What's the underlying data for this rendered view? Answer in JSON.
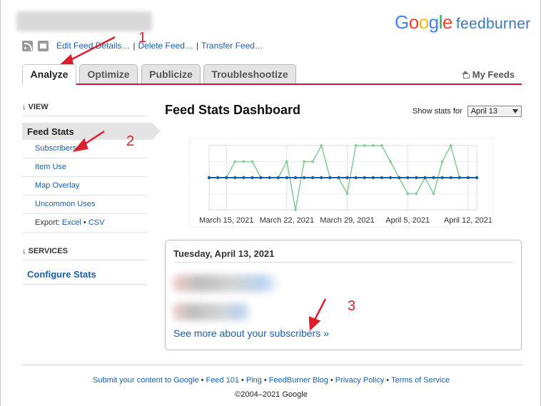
{
  "header": {
    "logo_google": "Google",
    "logo_feedburner": "feedburner",
    "feed_actions": [
      {
        "label": "Edit Feed Details…"
      },
      {
        "label": "Delete Feed…"
      },
      {
        "label": "Transfer Feed…"
      }
    ],
    "separator": "|"
  },
  "tabs": [
    {
      "label": "Analyze",
      "active": true
    },
    {
      "label": "Optimize",
      "active": false
    },
    {
      "label": "Publicize",
      "active": false
    },
    {
      "label": "Troubleshootize",
      "active": false
    }
  ],
  "my_feeds": "My Feeds",
  "sidebar": {
    "view_arrow": "↓",
    "view_heading": "VIEW",
    "current": "Feed Stats",
    "items": [
      {
        "label": "Subscribers"
      },
      {
        "label": "Item Use"
      },
      {
        "label": "Map Overlay"
      },
      {
        "label": "Uncommon Uses"
      }
    ],
    "export_label": "Export:",
    "export_excel": "Excel",
    "export_bullet": "•",
    "export_csv": "CSV",
    "services_arrow": "↓",
    "services_heading": "SERVICES",
    "configure": "Configure Stats"
  },
  "main": {
    "title": "Feed Stats Dashboard",
    "show_stats_label": "Show stats for",
    "show_stats_value": "April 13",
    "day_title": "Tuesday, April 13, 2021",
    "see_more": "See more about your subscribers »"
  },
  "chart_data": {
    "type": "line",
    "x_tick_labels": [
      "March 15, 2021",
      "March 22, 2021",
      "March 29, 2021",
      "April 5, 2021",
      "April 12, 2021"
    ],
    "x": [
      "Mar 13",
      "Mar 14",
      "Mar 15",
      "Mar 16",
      "Mar 17",
      "Mar 18",
      "Mar 19",
      "Mar 20",
      "Mar 21",
      "Mar 22",
      "Mar 23",
      "Mar 24",
      "Mar 25",
      "Mar 26",
      "Mar 27",
      "Mar 28",
      "Mar 29",
      "Mar 30",
      "Mar 31",
      "Apr 1",
      "Apr 2",
      "Apr 3",
      "Apr 4",
      "Apr 5",
      "Apr 6",
      "Apr 7",
      "Apr 8",
      "Apr 9",
      "Apr 10",
      "Apr 11",
      "Apr 12",
      "Apr 13"
    ],
    "series": [
      {
        "color": "#88cc99",
        "values": [
          0,
          0,
          0,
          1,
          1,
          1,
          0,
          0,
          0,
          1,
          -2,
          1,
          1,
          2,
          0,
          0,
          -1,
          2,
          2,
          2,
          2,
          1,
          0,
          -1,
          -1,
          0,
          -1,
          1,
          2,
          0,
          0,
          0
        ]
      },
      {
        "color": "#1c5e9c",
        "values": [
          0,
          0,
          0,
          0,
          0,
          0,
          0,
          0,
          0,
          0,
          0,
          0,
          0,
          0,
          0,
          0,
          0,
          0,
          0,
          0,
          0,
          0,
          0,
          0,
          0,
          0,
          0,
          0,
          0,
          0,
          0,
          0
        ]
      }
    ],
    "grid": true
  },
  "footer": {
    "links": [
      {
        "label": "Submit your content to Google"
      },
      {
        "label": "Feed 101"
      },
      {
        "label": "Ping"
      },
      {
        "label": "FeedBurner Blog"
      },
      {
        "label": "Privacy Policy"
      },
      {
        "label": "Terms of Service"
      }
    ],
    "bullet": "•",
    "copyright": "©2004–2021 Google"
  },
  "annotations": [
    "1",
    "2",
    "3"
  ],
  "colors": {
    "accent_red": "#d6143d",
    "link_blue": "#1a5faa",
    "annotation_red": "#dd1e2f",
    "chart_green": "#88cc99",
    "chart_blue": "#1c5e9c"
  }
}
